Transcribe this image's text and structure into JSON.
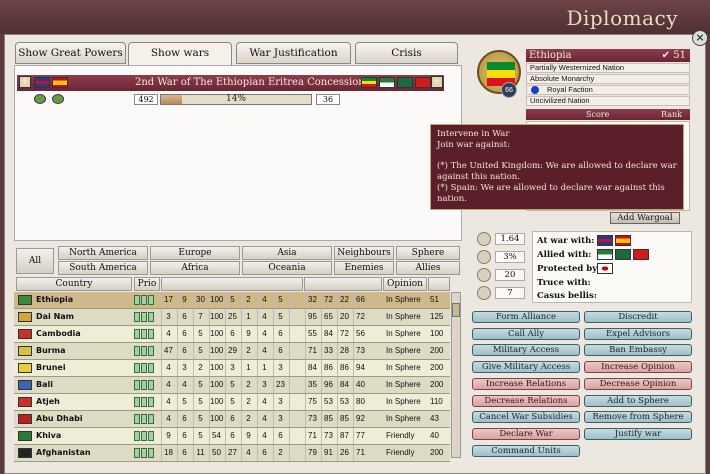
{
  "window": {
    "title": "Diplomacy",
    "close": "×"
  },
  "tabs": [
    {
      "label": "Show Great Powers"
    },
    {
      "label": "Show wars"
    },
    {
      "label": "War Justification"
    },
    {
      "label": "Crisis"
    }
  ],
  "war": {
    "plus": "+",
    "title": "2nd  War of The Ethiopian Eritrea Concession",
    "attacker_score": "492",
    "progress_label": "14%",
    "progress_fraction": 0.14,
    "defender_score": "36"
  },
  "filters": {
    "all": "All",
    "north_america": "North America",
    "south_america": "South America",
    "europe": "Europe",
    "africa": "Africa",
    "asia": "Asia",
    "oceania": "Oceania",
    "neighbours": "Neighbours",
    "enemies": "Enemies",
    "sphere": "Sphere",
    "allies": "Allies"
  },
  "table": {
    "headers": {
      "country": "Country",
      "prio": "Prio",
      "opinion": "Opinion"
    },
    "rows": [
      {
        "name": "Ethiopia",
        "c": [
          "17",
          "9",
          "30",
          "100",
          "5",
          "2",
          "4",
          "5",
          "",
          "32",
          "72",
          "22",
          "66"
        ],
        "op": "In Sphere",
        "n": "51",
        "flag": "#3a8a3a"
      },
      {
        "name": "Dai Nam",
        "c": [
          "3",
          "6",
          "7",
          "100",
          "25",
          "1",
          "4",
          "5",
          "",
          "95",
          "65",
          "20",
          "72"
        ],
        "op": "In Sphere",
        "n": "125",
        "flag": "#d6a23a"
      },
      {
        "name": "Cambodia",
        "c": [
          "4",
          "6",
          "5",
          "100",
          "6",
          "9",
          "4",
          "6",
          "",
          "55",
          "84",
          "72",
          "56"
        ],
        "op": "In Sphere",
        "n": "100",
        "flag": "#c83030"
      },
      {
        "name": "Burma",
        "c": [
          "47",
          "6",
          "5",
          "100",
          "29",
          "2",
          "4",
          "6",
          "",
          "71",
          "33",
          "28",
          "73"
        ],
        "op": "In Sphere",
        "n": "200",
        "flag": "#d8c040"
      },
      {
        "name": "Brunei",
        "c": [
          "4",
          "3",
          "2",
          "100",
          "3",
          "1",
          "1",
          "3",
          "",
          "84",
          "86",
          "86",
          "94"
        ],
        "op": "In Sphere",
        "n": "200",
        "flag": "#e6d040"
      },
      {
        "name": "Bali",
        "c": [
          "4",
          "4",
          "5",
          "100",
          "5",
          "2",
          "3",
          "23",
          "",
          "35",
          "96",
          "84",
          "40"
        ],
        "op": "In Sphere",
        "n": "200",
        "flag": "#4060b0"
      },
      {
        "name": "Atjeh",
        "c": [
          "4",
          "5",
          "5",
          "100",
          "5",
          "2",
          "4",
          "3",
          "",
          "75",
          "53",
          "53",
          "80"
        ],
        "op": "In Sphere",
        "n": "110",
        "flag": "#c83030"
      },
      {
        "name": "Abu Dhabi",
        "c": [
          "4",
          "6",
          "5",
          "100",
          "6",
          "2",
          "4",
          "3",
          "",
          "73",
          "85",
          "85",
          "92"
        ],
        "op": "In Sphere",
        "n": "43",
        "flag": "#b82020"
      },
      {
        "name": "Khiva",
        "c": [
          "9",
          "6",
          "5",
          "54",
          "6",
          "9",
          "4",
          "6",
          "",
          "71",
          "73",
          "87",
          "77"
        ],
        "op": "Friendly",
        "n": "40",
        "flag": "#2a7a3a"
      },
      {
        "name": "Afghanistan",
        "c": [
          "18",
          "6",
          "11",
          "50",
          "27",
          "4",
          "6",
          "2",
          "",
          "79",
          "91",
          "26",
          "71"
        ],
        "op": "Friendly",
        "n": "200",
        "flag": "#222222"
      }
    ]
  },
  "country": {
    "name": "Ethiopia",
    "score_icon": "✔",
    "rank_score": "51",
    "rank": "66",
    "lines": [
      "Partially Westernized Nation",
      "Absolute Monarchy",
      "Royal Faction",
      "Uncivilized Nation"
    ],
    "score_header": "Score",
    "rank_header": "Rank"
  },
  "tooltip": {
    "line1": "Intervene in War",
    "line2": "Join war against:",
    "line3": "(*) The United Kingdom: We are allowed to declare war",
    "line4": "against this nation.",
    "line5": "(*) Spain: We are allowed to declare war against this nation."
  },
  "add_wargoal": "Add Wargoal",
  "stats": [
    "1.64",
    "3%",
    "20",
    "7"
  ],
  "relations": {
    "at_war": "At war with:",
    "allied": "Allied with:",
    "protected": "Protected by:",
    "truce": "Truce with:",
    "casus": "Casus bellis:"
  },
  "actions": [
    [
      "Form Alliance",
      "Discredit"
    ],
    [
      "Call Ally",
      "Expel Advisors"
    ],
    [
      "Military Access",
      "Ban Embassy"
    ],
    [
      "Give Military Access",
      "Increase Opinion"
    ],
    [
      "Increase Relations",
      "Decrease Opinion"
    ],
    [
      "Decrease Relations",
      "Add to Sphere"
    ],
    [
      "Cancel War Subsidies",
      "Remove from Sphere"
    ],
    [
      "Declare War",
      "Justify war"
    ],
    [
      "Command Units",
      ""
    ]
  ]
}
